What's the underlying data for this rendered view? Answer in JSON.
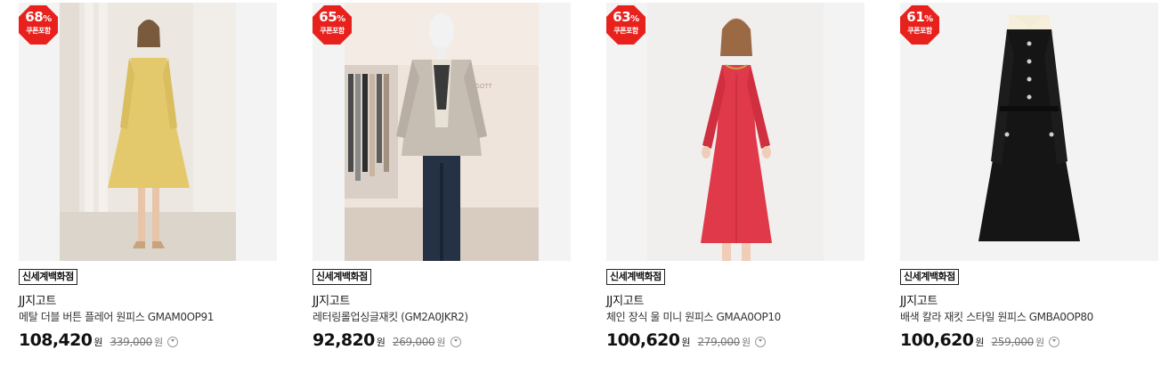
{
  "products": [
    {
      "discount": "68",
      "discount_symbol": "%",
      "coupon_label": "쿠폰포함",
      "store": "신세계백화점",
      "brand": "JJ지고트",
      "title": "메탈 더블 버튼 플레어 원피스 GMAM0OP91",
      "sale_price": "108,420",
      "currency": "원",
      "original_price": "339,000",
      "original_currency": "원",
      "info_icon": "chevron-down-circle-icon",
      "image_icon": "yellow-tweed-dress-photo"
    },
    {
      "discount": "65",
      "discount_symbol": "%",
      "coupon_label": "쿠폰포함",
      "store": "신세계백화점",
      "brand": "JJ지고트",
      "title": "레터링롤업싱글재킷 (GM2A0JKR2)",
      "sale_price": "92,820",
      "currency": "원",
      "original_price": "269,000",
      "original_currency": "원",
      "info_icon": "chevron-down-circle-icon",
      "image_icon": "mannequin-jacket-photo",
      "store_sign": "JJ JIGOTT"
    },
    {
      "discount": "63",
      "discount_symbol": "%",
      "coupon_label": "쿠폰포함",
      "store": "신세계백화점",
      "brand": "JJ지고트",
      "title": "체인 장식 울 미니 원피스 GMAA0OP10",
      "sale_price": "100,620",
      "currency": "원",
      "original_price": "279,000",
      "original_currency": "원",
      "info_icon": "chevron-down-circle-icon",
      "image_icon": "red-wool-dress-photo"
    },
    {
      "discount": "61",
      "discount_symbol": "%",
      "coupon_label": "쿠폰포함",
      "store": "신세계백화점",
      "brand": "JJ지고트",
      "title": "배색 칼라 재킷 스타일 원피스 GMBA0OP80",
      "sale_price": "100,620",
      "currency": "원",
      "original_price": "259,000",
      "original_currency": "원",
      "info_icon": "chevron-down-circle-icon",
      "image_icon": "black-collar-dress-photo"
    }
  ],
  "colors": {
    "badge_red": "#e8211d",
    "text_primary": "#111111",
    "text_muted": "#777777",
    "thumb_bg": "#f3f3f3"
  }
}
